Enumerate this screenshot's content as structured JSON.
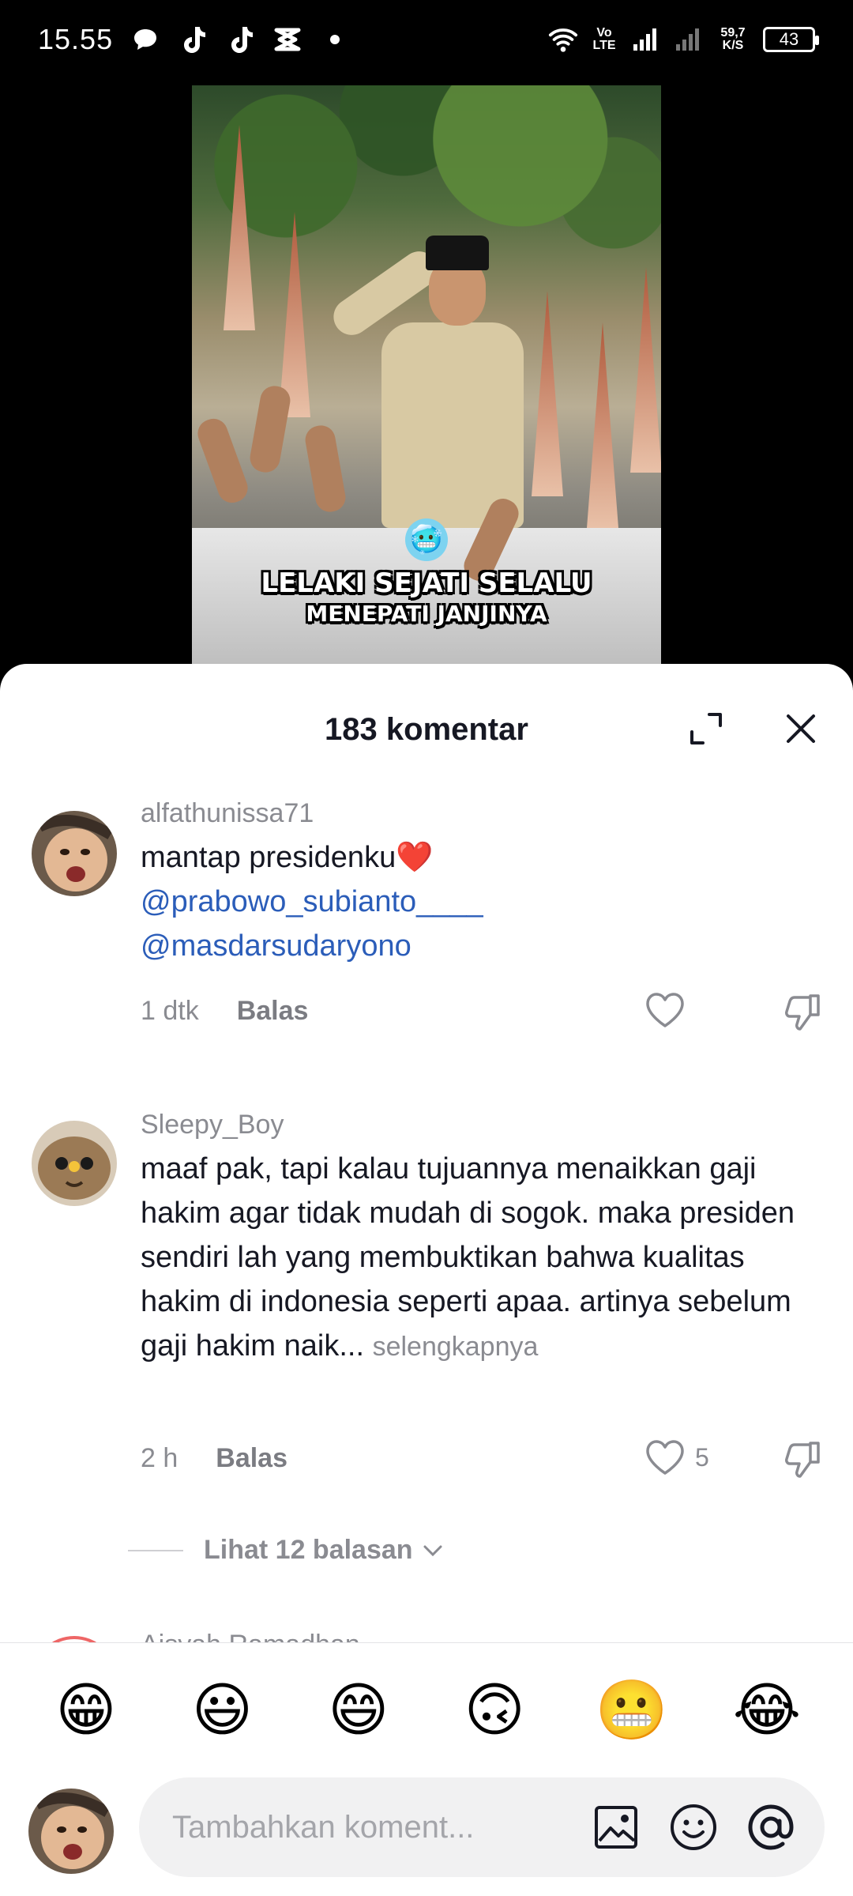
{
  "status_bar": {
    "time": "15.55",
    "network": "Vo LTE",
    "speed_value": "59,7",
    "speed_unit": "K/S",
    "battery": "43"
  },
  "video": {
    "caption_line1": "LELAKI SEJATI SELALU",
    "caption_line2": "MENEPATI JANJINYA",
    "emoji": "🥶"
  },
  "sheet": {
    "title": "183 komentar"
  },
  "comments": [
    {
      "username": "alfathunissa71",
      "text": "mantap presidenku❤️",
      "mentions": [
        "@prabowo_subianto____",
        "@masdarsudaryono"
      ],
      "time": "1 dtk",
      "reply_label": "Balas",
      "likes": ""
    },
    {
      "username": "Sleepy_Boy",
      "text": "maaf pak, tapi kalau tujuannya menaikkan gaji hakim agar tidak mudah di sogok. maka presiden sendiri lah yang membuktikan bahwa kualitas hakim di indonesia seperti apaa. artinya sebelum gaji hakim naik...",
      "more_label": "selengkapnya",
      "time": "2 h",
      "reply_label": "Balas",
      "likes": "5"
    }
  ],
  "replies": {
    "label": "Lihat 12 balasan"
  },
  "peek_comment": {
    "username": "Aisyah Ramadhan"
  },
  "emoji_bar": [
    "😁",
    "😃",
    "😄",
    "🙃",
    "😬",
    "😂"
  ],
  "compose": {
    "placeholder": "Tambahkan koment..."
  }
}
